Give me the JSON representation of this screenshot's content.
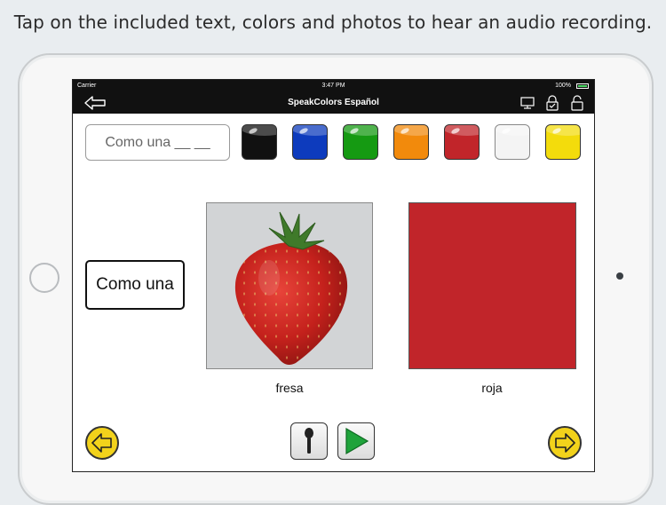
{
  "headline": "Tap on the included text, colors and photos to hear an audio recording.",
  "status_bar": {
    "carrier": "Carrier",
    "time": "3:47 PM",
    "battery": "100%"
  },
  "nav": {
    "title": "SpeakColors Español"
  },
  "phrase_field": {
    "value": "Como una __ __"
  },
  "swatches": [
    {
      "name": "black",
      "color": "#111111"
    },
    {
      "name": "blue",
      "color": "#0d3bbd"
    },
    {
      "name": "green",
      "color": "#159a12"
    },
    {
      "name": "orange",
      "color": "#f28a0c"
    },
    {
      "name": "red",
      "color": "#c1252a"
    },
    {
      "name": "white",
      "color": "#f4f4f4"
    },
    {
      "name": "yellow",
      "color": "#f3dc0c"
    }
  ],
  "sentence_card": {
    "text": "Como una"
  },
  "photo_card": {
    "label": "fresa"
  },
  "color_card": {
    "label": "roja",
    "color": "#c1252a"
  },
  "controls": {
    "prev_icon": "arrow-left-icon",
    "next_icon": "arrow-right-icon",
    "record_icon": "microphone-icon",
    "play_icon": "play-icon"
  }
}
